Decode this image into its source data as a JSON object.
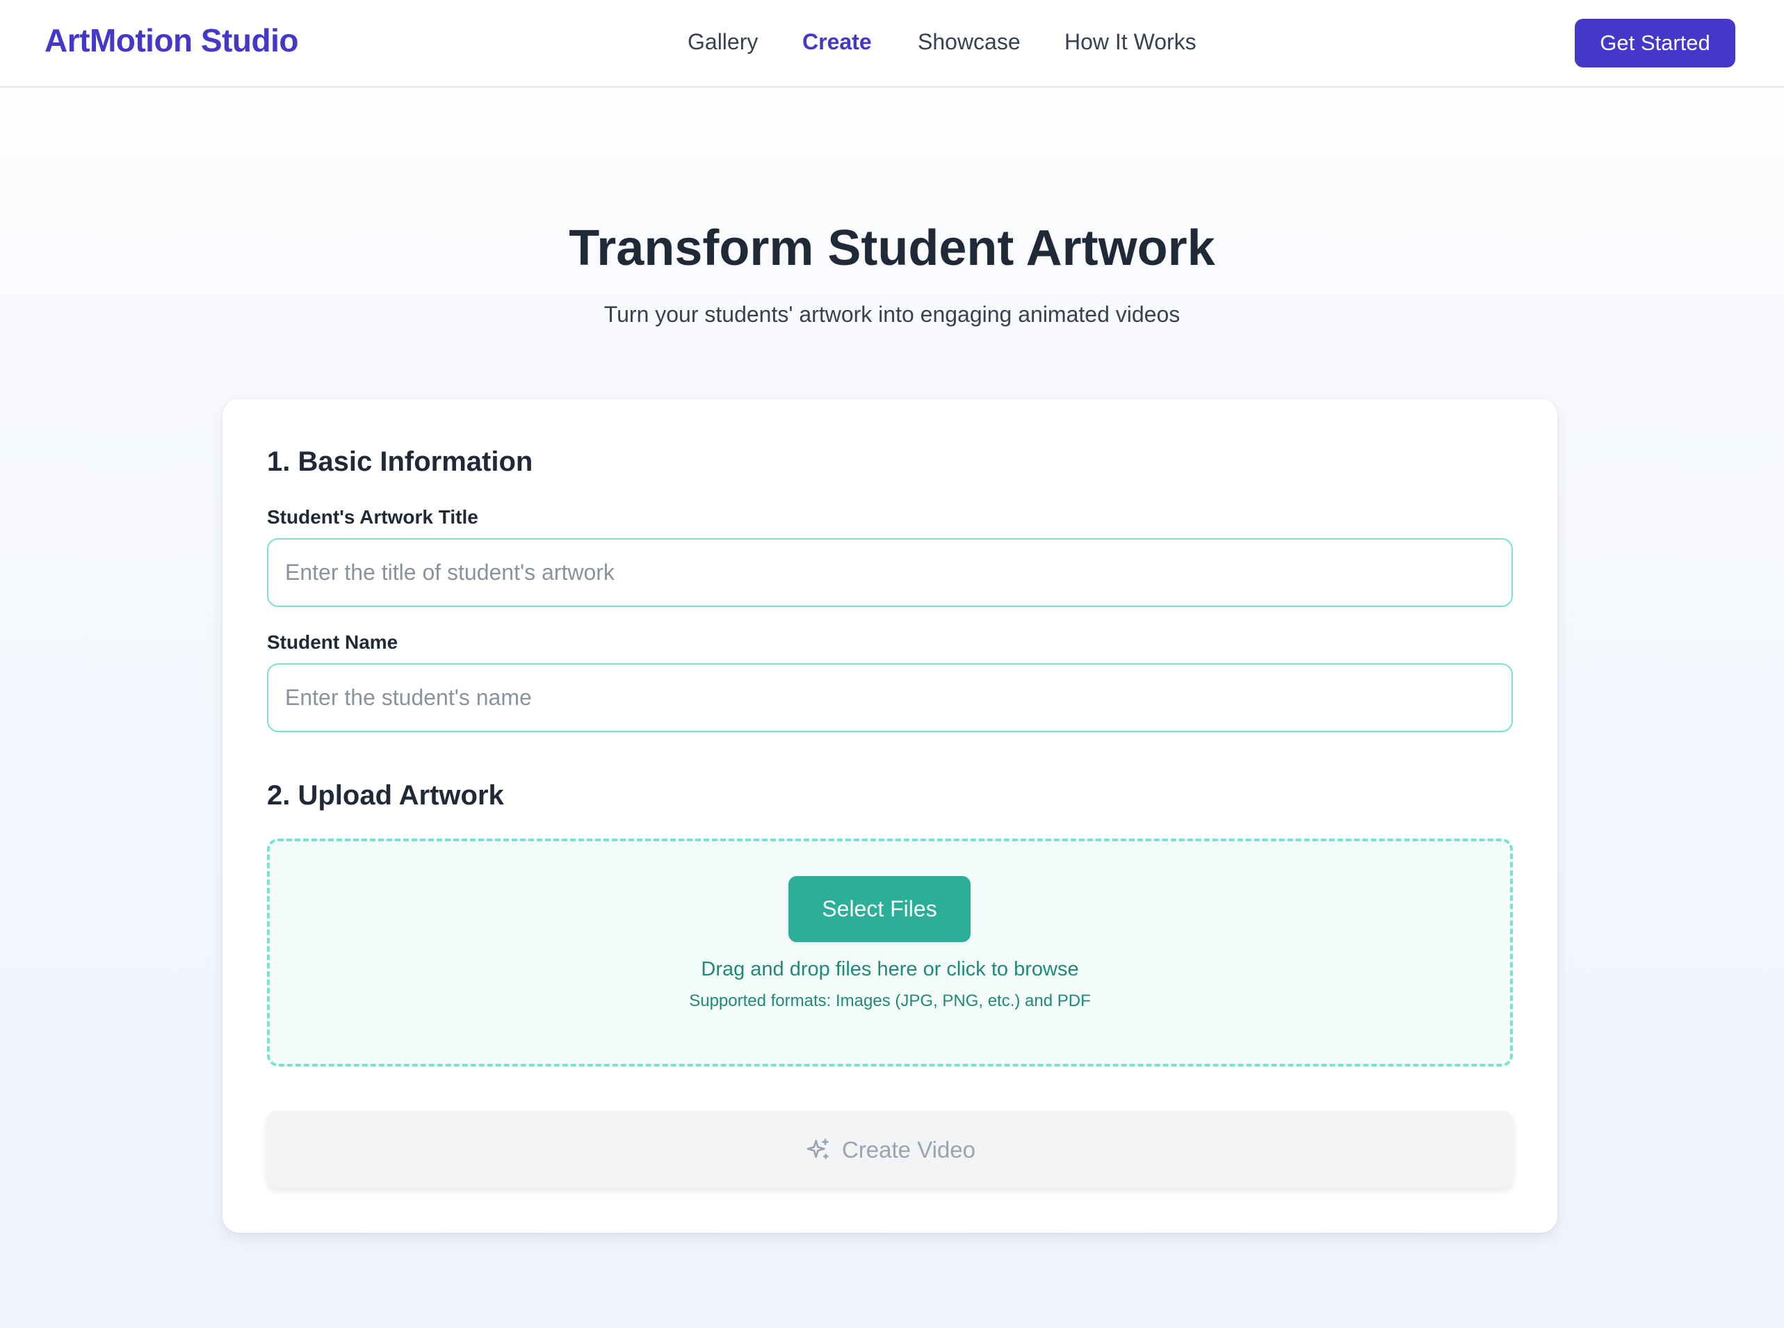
{
  "brand": "ArtMotion Studio",
  "nav": {
    "items": [
      {
        "label": "Gallery",
        "active": false
      },
      {
        "label": "Create",
        "active": true
      },
      {
        "label": "Showcase",
        "active": false
      },
      {
        "label": "How It Works",
        "active": false
      }
    ],
    "cta_label": "Get Started"
  },
  "hero": {
    "title": "Transform Student Artwork",
    "subtitle": "Turn your students' artwork into engaging animated videos"
  },
  "form": {
    "basic_info": {
      "title": "1. Basic Information",
      "artwork_title_label": "Student's Artwork Title",
      "artwork_title_placeholder": "Enter the title of student's artwork",
      "artwork_title_value": "",
      "student_name_label": "Student Name",
      "student_name_placeholder": "Enter the student's name",
      "student_name_value": ""
    },
    "upload": {
      "title": "2. Upload Artwork",
      "select_label": "Select Files",
      "hint": "Drag and drop files here or click to browse",
      "formats": "Supported formats: Images (JPG, PNG, etc.) and PDF"
    },
    "submit": {
      "label": "Create Video",
      "icon": "sparkles-icon",
      "disabled": true
    }
  },
  "colors": {
    "primary": "#4338ca",
    "teal": "#2baf98",
    "input_border": "#7ae3cf",
    "disabled_bg": "#f2f3f5"
  }
}
